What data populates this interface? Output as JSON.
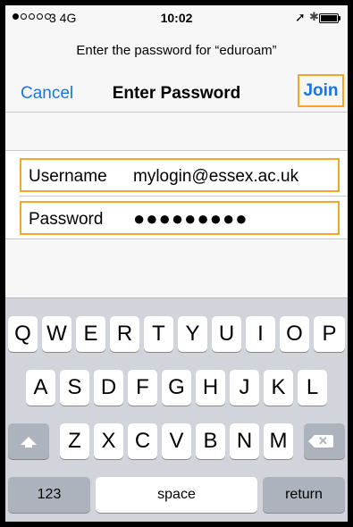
{
  "status_bar": {
    "signal": "●○○○○",
    "carrier": "3  4G",
    "time": "10:02",
    "location_icon": "➚",
    "bluetooth_icon": "✱"
  },
  "prompt": "Enter the password for “eduroam”",
  "nav": {
    "cancel": "Cancel",
    "title": "Enter Password",
    "join": "Join"
  },
  "form": {
    "username_label": "Username",
    "username_value": "mylogin@essex.ac.uk",
    "password_label": "Password",
    "password_value": "●●●●●●●●●"
  },
  "keyboard": {
    "row1": [
      "Q",
      "W",
      "E",
      "R",
      "T",
      "Y",
      "U",
      "I",
      "O",
      "P"
    ],
    "row2": [
      "A",
      "S",
      "D",
      "F",
      "G",
      "H",
      "J",
      "K",
      "L"
    ],
    "row3": [
      "Z",
      "X",
      "C",
      "V",
      "B",
      "N",
      "M"
    ],
    "numbers": "123",
    "space": "space",
    "return": "return",
    "shift_icon": "shift-icon",
    "delete_icon": "backspace-icon"
  },
  "colors": {
    "accent": "#1a73e8",
    "highlight": "#f4a62a"
  }
}
